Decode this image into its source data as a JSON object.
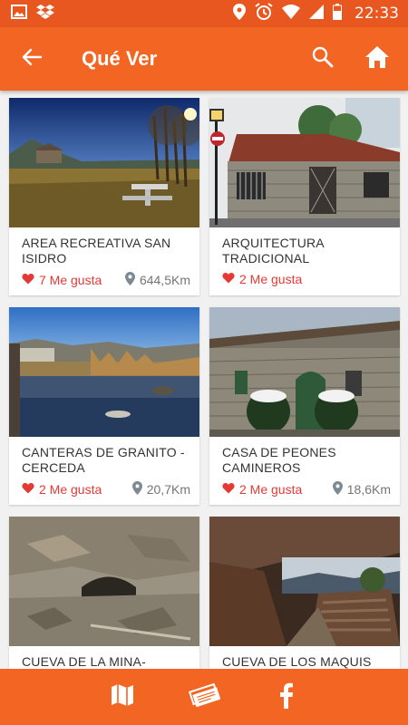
{
  "status_bar": {
    "time": "22:33",
    "icons": [
      "image-icon",
      "dropbox-icon",
      "location-icon",
      "alarm-icon",
      "wifi-icon",
      "signal-icon",
      "battery-icon"
    ]
  },
  "app_bar": {
    "title": "Qué Ver",
    "back_icon": "arrow-back-icon",
    "search_icon": "search-icon",
    "home_icon": "home-icon"
  },
  "colors": {
    "primary": "#f26522",
    "status_bar": "#e8571f",
    "like": "#e53935",
    "distance": "#757575"
  },
  "places": [
    {
      "title": "AREA RECREATIVA SAN ISIDRO",
      "likes": "7 Me gusta",
      "distance": "644,5Km"
    },
    {
      "title": "ARQUITECTURA TRADICIONAL",
      "likes": "2 Me gusta",
      "distance": ""
    },
    {
      "title": "CANTERAS DE GRANITO - CERCEDA",
      "likes": "2 Me gusta",
      "distance": "20,7Km"
    },
    {
      "title": "CASA DE PEONES CAMINEROS",
      "likes": "2 Me gusta",
      "distance": "18,6Km"
    },
    {
      "title": "CUEVA DE LA MINA-",
      "likes": "",
      "distance": ""
    },
    {
      "title": "CUEVA DE LOS MAQUIS",
      "likes": "",
      "distance": ""
    }
  ],
  "bottom_bar": {
    "icons": [
      "map-icon",
      "tickets-icon",
      "facebook-icon"
    ]
  }
}
